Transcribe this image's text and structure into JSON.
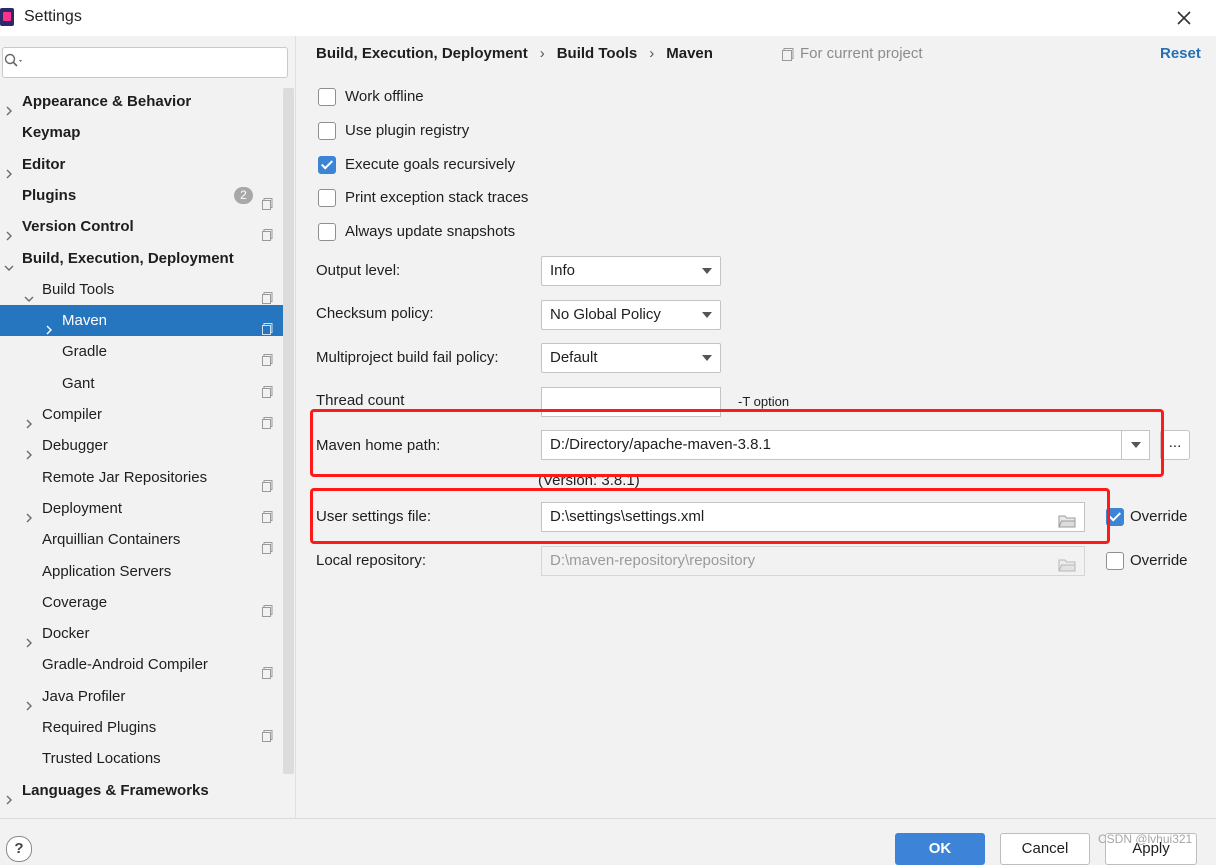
{
  "window": {
    "title": "Settings"
  },
  "sidebar": {
    "search_placeholder": "",
    "items": [
      {
        "label": "Appearance & Behavior",
        "level": 0,
        "bold": true,
        "expandable": true,
        "expanded": false,
        "selected": false,
        "project_icon": false
      },
      {
        "label": "Keymap",
        "level": 0,
        "bold": true,
        "expandable": false,
        "selected": false,
        "project_icon": false
      },
      {
        "label": "Editor",
        "level": 0,
        "bold": true,
        "expandable": true,
        "expanded": false,
        "selected": false,
        "project_icon": false
      },
      {
        "label": "Plugins",
        "level": 0,
        "bold": true,
        "expandable": false,
        "selected": false,
        "project_icon": true,
        "badge": "2"
      },
      {
        "label": "Version Control",
        "level": 0,
        "bold": true,
        "expandable": true,
        "expanded": false,
        "selected": false,
        "project_icon": true
      },
      {
        "label": "Build, Execution, Deployment",
        "level": 0,
        "bold": true,
        "expandable": true,
        "expanded": true,
        "selected": false,
        "project_icon": false
      },
      {
        "label": "Build Tools",
        "level": 1,
        "bold": false,
        "expandable": true,
        "expanded": true,
        "selected": false,
        "project_icon": true
      },
      {
        "label": "Maven",
        "level": 2,
        "bold": false,
        "expandable": true,
        "expanded": false,
        "selected": true,
        "project_icon": true
      },
      {
        "label": "Gradle",
        "level": 2,
        "bold": false,
        "expandable": false,
        "selected": false,
        "project_icon": true
      },
      {
        "label": "Gant",
        "level": 2,
        "bold": false,
        "expandable": false,
        "selected": false,
        "project_icon": true
      },
      {
        "label": "Compiler",
        "level": 1,
        "bold": false,
        "expandable": true,
        "expanded": false,
        "selected": false,
        "project_icon": true
      },
      {
        "label": "Debugger",
        "level": 1,
        "bold": false,
        "expandable": true,
        "expanded": false,
        "selected": false,
        "project_icon": false
      },
      {
        "label": "Remote Jar Repositories",
        "level": 1,
        "bold": false,
        "expandable": false,
        "selected": false,
        "project_icon": true
      },
      {
        "label": "Deployment",
        "level": 1,
        "bold": false,
        "expandable": true,
        "expanded": false,
        "selected": false,
        "project_icon": true
      },
      {
        "label": "Arquillian Containers",
        "level": 1,
        "bold": false,
        "expandable": false,
        "selected": false,
        "project_icon": true
      },
      {
        "label": "Application Servers",
        "level": 1,
        "bold": false,
        "expandable": false,
        "selected": false,
        "project_icon": false
      },
      {
        "label": "Coverage",
        "level": 1,
        "bold": false,
        "expandable": false,
        "selected": false,
        "project_icon": true
      },
      {
        "label": "Docker",
        "level": 1,
        "bold": false,
        "expandable": true,
        "expanded": false,
        "selected": false,
        "project_icon": false
      },
      {
        "label": "Gradle-Android Compiler",
        "level": 1,
        "bold": false,
        "expandable": false,
        "selected": false,
        "project_icon": true
      },
      {
        "label": "Java Profiler",
        "level": 1,
        "bold": false,
        "expandable": true,
        "expanded": false,
        "selected": false,
        "project_icon": false
      },
      {
        "label": "Required Plugins",
        "level": 1,
        "bold": false,
        "expandable": false,
        "selected": false,
        "project_icon": true
      },
      {
        "label": "Trusted Locations",
        "level": 1,
        "bold": false,
        "expandable": false,
        "selected": false,
        "project_icon": false
      },
      {
        "label": "Languages & Frameworks",
        "level": 0,
        "bold": true,
        "expandable": true,
        "expanded": false,
        "selected": false,
        "project_icon": false
      }
    ]
  },
  "header": {
    "breadcrumb": [
      "Build, Execution, Deployment",
      "Build Tools",
      "Maven"
    ],
    "separator": "›",
    "scope_label": "For current project",
    "reset_label": "Reset"
  },
  "options": {
    "checkboxes": [
      {
        "label": "Work offline",
        "checked": false
      },
      {
        "label": "Use plugin registry",
        "checked": false
      },
      {
        "label": "Execute goals recursively",
        "checked": true
      },
      {
        "label": "Print exception stack traces",
        "checked": false
      },
      {
        "label": "Always update snapshots",
        "checked": false
      }
    ],
    "output_level": {
      "label": "Output level:",
      "value": "Info"
    },
    "checksum_policy": {
      "label": "Checksum policy:",
      "value": "No Global Policy"
    },
    "multiproject_fail_policy": {
      "label": "Multiproject build fail policy:",
      "value": "Default"
    },
    "thread_count": {
      "label": "Thread count",
      "value": "",
      "hint": "-T option"
    },
    "maven_home": {
      "label": "Maven home path:",
      "value": "D:/Directory/apache-maven-3.8.1",
      "browse_label": "...",
      "version": "(Version: 3.8.1)"
    },
    "user_settings": {
      "label": "User settings file:",
      "value": "D:\\settings\\settings.xml",
      "override_label": "Override",
      "override_checked": true
    },
    "local_repo": {
      "label": "Local repository:",
      "value": "D:\\maven-repository\\repository",
      "override_label": "Override",
      "override_checked": false
    }
  },
  "footer": {
    "help_label": "?",
    "ok_label": "OK",
    "cancel_label": "Cancel",
    "apply_label": "Apply"
  },
  "watermark": "CSDN @lvhui321",
  "colors": {
    "accent": "#2675bf",
    "highlight_box": "#ff1a1a",
    "link": "#2470b3"
  }
}
